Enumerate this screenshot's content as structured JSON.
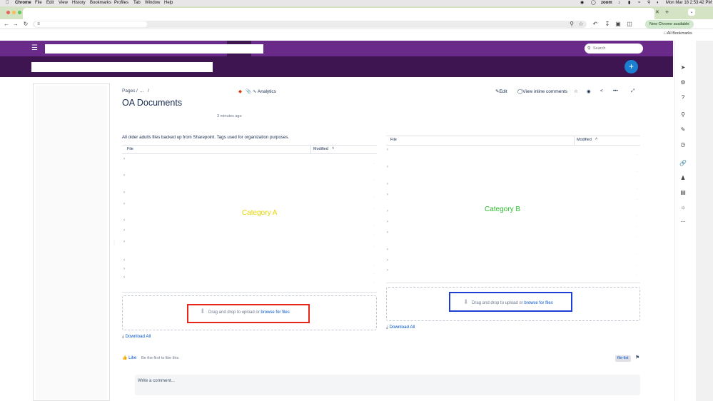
{
  "mac_menubar": {
    "app": "Chrome",
    "menus": [
      "File",
      "Edit",
      "View",
      "History",
      "Bookmarks",
      "Profiles",
      "Tab",
      "Window",
      "Help"
    ],
    "zoom_label": "zoom",
    "clock": "Mon Mar 18  2:53:42 PM"
  },
  "browser": {
    "new_chrome_label": "New Chrome available",
    "all_bookmarks": "All Bookmarks"
  },
  "header": {
    "search_placeholder": "Search",
    "create_label": "+"
  },
  "breadcrumb": {
    "pages": "Pages",
    "sep1": "/",
    "ellipsis": "...",
    "sep2": "/"
  },
  "page": {
    "analytics": "Analytics",
    "edit": "Edit",
    "view_inline_comments": "View inline comments",
    "more": "•••",
    "title": "OA Documents",
    "updated": "3 minutes ago",
    "description": "All older adults files backed up from Sharepoint. Tags used for organization purposes."
  },
  "table_a": {
    "col_file": "File",
    "col_modified": "Modified",
    "sort_indicator": "˄",
    "category_label": "Category A",
    "drop_text": "Drag and drop to upload or ",
    "drop_link": "browse for files",
    "download_all": "Download All"
  },
  "table_b": {
    "col_file": "File",
    "col_modified": "Modified",
    "sort_indicator": "˄",
    "category_label": "Category B",
    "drop_text": "Drag and drop to upload or ",
    "drop_link": "browse for files",
    "download_all": "Download All"
  },
  "footer": {
    "like": "Like",
    "like_hint": "Be the first to like this",
    "tag": "file-list",
    "comment_placeholder": "Write a comment..."
  },
  "colors": {
    "header_purple": "#6a2a8a",
    "header_dark": "#3e1550",
    "link_blue": "#0052cc",
    "category_a": "#e6d400",
    "category_b": "#2bbf2b",
    "highlight_red": "#e8261a",
    "highlight_blue": "#1e3ed6"
  }
}
